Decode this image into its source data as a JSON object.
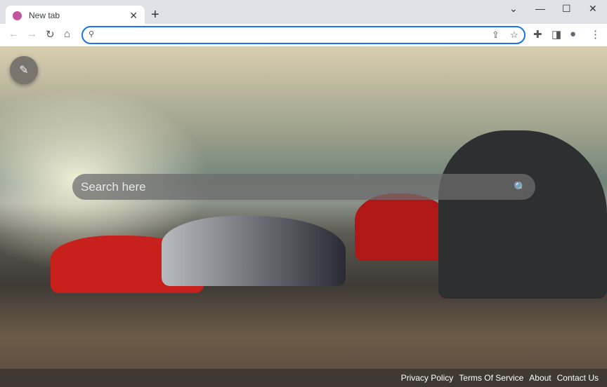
{
  "tab": {
    "title": "New tab",
    "close": "✕",
    "new_tab": "+"
  },
  "window": {
    "dropdown": "⌄",
    "minimize": "—",
    "maximize": "☐",
    "close": "✕"
  },
  "toolbar": {
    "back": "←",
    "forward": "→",
    "reload": "↻",
    "home": "⌂",
    "address_value": "",
    "share": "⇪",
    "star": "☆",
    "extensions": "✚",
    "sidepanel": "◨",
    "profile": "●",
    "menu": "⋮"
  },
  "page": {
    "edit_icon": "✎",
    "search_placeholder": "Search here",
    "search_icon": "🔍"
  },
  "footer": {
    "links": [
      "Privacy Policy",
      "Terms Of Service",
      "About",
      "Contact Us"
    ]
  }
}
